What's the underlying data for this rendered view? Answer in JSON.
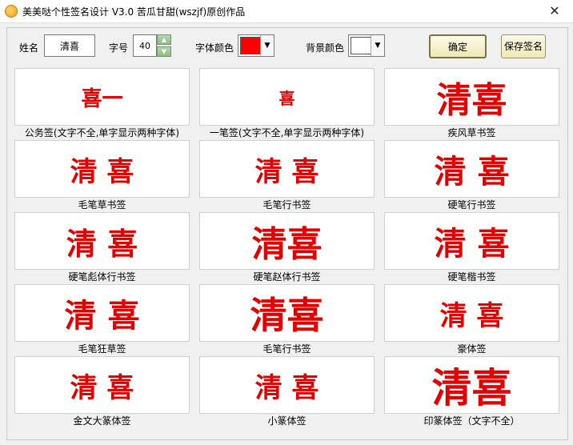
{
  "window": {
    "title": "美美哒个性签名设计 V3.0    苦瓜甘甜(wszjf)原创作品",
    "close_glyph": "✕"
  },
  "form": {
    "name_label": "姓名",
    "name_value": "清喜",
    "size_label": "字号",
    "size_value": "40",
    "font_color_label": "字体颜色",
    "font_color": "#ff0000",
    "bg_color_label": "背景颜色",
    "bg_color": "#ffffff",
    "ok_label": "确定",
    "save_label": "保存签名"
  },
  "signature_color": "#e00000",
  "styles": [
    {
      "caption": "公务签(文字不全,单字显示两种字体)",
      "text": "喜一"
    },
    {
      "caption": "一笔签(文字不全,单字显示两种字体)",
      "text": "喜"
    },
    {
      "caption": "疾风草书签",
      "text": "清喜"
    },
    {
      "caption": "毛笔草书签",
      "text": "清 喜"
    },
    {
      "caption": "毛笔行书签",
      "text": "清 喜"
    },
    {
      "caption": "硬笔行书签",
      "text": "清 喜"
    },
    {
      "caption": "硬笔彪体行书签",
      "text": "清 喜"
    },
    {
      "caption": "硬笔赵体行书签",
      "text": "清喜"
    },
    {
      "caption": "硬笔楷书签",
      "text": "清 喜"
    },
    {
      "caption": "毛笔狂草签",
      "text": "清 喜"
    },
    {
      "caption": "毛笔行书签",
      "text": "清喜"
    },
    {
      "caption": "豪体签",
      "text": "清 喜"
    },
    {
      "caption": "金文大篆体签",
      "text": "清 喜"
    },
    {
      "caption": "小篆体签",
      "text": "清 喜"
    },
    {
      "caption": "印篆体签（文字不全）",
      "text": "清喜"
    }
  ]
}
